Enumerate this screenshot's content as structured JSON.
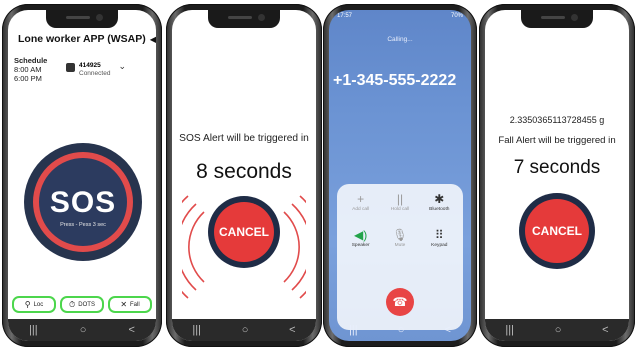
{
  "phone1": {
    "app_title": "Lone worker APP (WSAP)",
    "speaker_icon": "speaker-icon",
    "schedule_label": "Schedule",
    "schedule_start": "8:00 AM",
    "schedule_end": "6:00 PM",
    "device_id": "414925",
    "device_status": "Connected",
    "sos_label": "SOS",
    "sos_sub": "Press - Pess 3 sec",
    "btn_loc": "Loc",
    "btn_dots": "DOTS",
    "btn_fall": "Fall",
    "nav": [
      "|||",
      "○",
      "<"
    ]
  },
  "phone2": {
    "alert_text": "SOS Alert will be triggered in",
    "countdown": "8 seconds",
    "cancel_label": "CANCEL",
    "nav": [
      "|||",
      "○",
      "<"
    ]
  },
  "phone3": {
    "status_time": "17:57",
    "status_right": "70%",
    "calling": "Calling...",
    "number": "+1-345-555-2222",
    "buttons": [
      {
        "label": "Add call",
        "icon": "+"
      },
      {
        "label": "Hold call",
        "icon": "||"
      },
      {
        "label": "Bluetooth",
        "icon": "✱"
      },
      {
        "label": "Speaker",
        "icon": "◀)"
      },
      {
        "label": "Mute",
        "icon": "🎙"
      },
      {
        "label": "Keypad",
        "icon": "⠿"
      }
    ],
    "nav": [
      "|||",
      "○",
      "<"
    ]
  },
  "phone4": {
    "g_value": "2.3350365113728455 g",
    "fall_text": "Fall Alert will be triggered in",
    "countdown": "7 seconds",
    "cancel_label": "CANCEL",
    "nav": [
      "|||",
      "○",
      "<"
    ]
  },
  "colors": {
    "sos_ring": "#e14b4b",
    "sos_fill": "#2c3b5f",
    "cancel_red": "#e53a3a",
    "highlight_green": "#4cd64c",
    "call_bg": "#6b93d3",
    "end_call": "#e84545"
  }
}
